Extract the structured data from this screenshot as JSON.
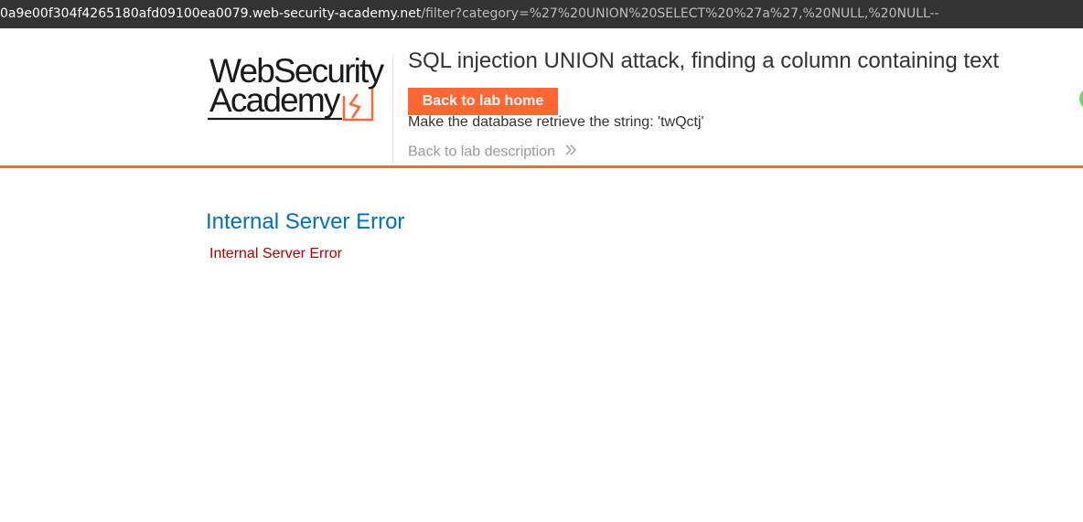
{
  "browser": {
    "url_host": "0a9e00f304f4265180afd09100ea0079.web-security-academy.net",
    "url_path": "/filter?category=%27%20UNION%20SELECT%20%27a%27,%20NULL,%20NULL--"
  },
  "logo": {
    "line1": "WebSecurity",
    "line2": "Academy",
    "icon": "lightning-bolt-icon"
  },
  "lab": {
    "title": "SQL injection UNION attack, finding a column containing text",
    "back_home_label": "Back to lab home",
    "objective": "Make the database retrieve the string: 'twQctj'",
    "back_description_label": "Back to lab description",
    "status_icon": "status-dot-icon"
  },
  "content": {
    "error_heading": "Internal Server Error",
    "error_message": "Internal Server Error"
  },
  "colors": {
    "accent": "#ff6633",
    "heading_blue": "#0071bc",
    "error_red": "#b50000",
    "status_green": "#70d16d"
  }
}
